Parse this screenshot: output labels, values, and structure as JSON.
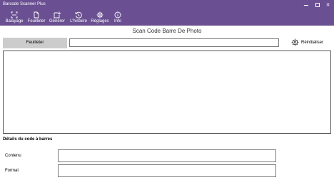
{
  "window": {
    "title": "Barcode Scanner Plus",
    "minimize_glyph": "",
    "maximize_glyph": "",
    "close_glyph": "✕"
  },
  "toolbar": {
    "items": [
      {
        "label": "Balayage",
        "icon": "scan-icon"
      },
      {
        "label": "Feuilleter",
        "icon": "browse-file-icon"
      },
      {
        "label": "Générer",
        "icon": "generate-icon"
      },
      {
        "label": "L'histoire",
        "icon": "history-icon"
      },
      {
        "label": "Réglages",
        "icon": "gear-icon"
      },
      {
        "label": "Info",
        "icon": "info-icon"
      }
    ]
  },
  "main": {
    "title": "Scan Code Barre De Photo",
    "browse_label": "Feuilleter",
    "path_value": "",
    "reset_label": "Réinitialiser"
  },
  "details": {
    "title": "Détails du code à barres",
    "content_label": "Contenu",
    "content_value": "",
    "format_label": "Format",
    "format_value": ""
  },
  "colors": {
    "accent": "#6a5092",
    "button_gray": "#cccccc"
  }
}
